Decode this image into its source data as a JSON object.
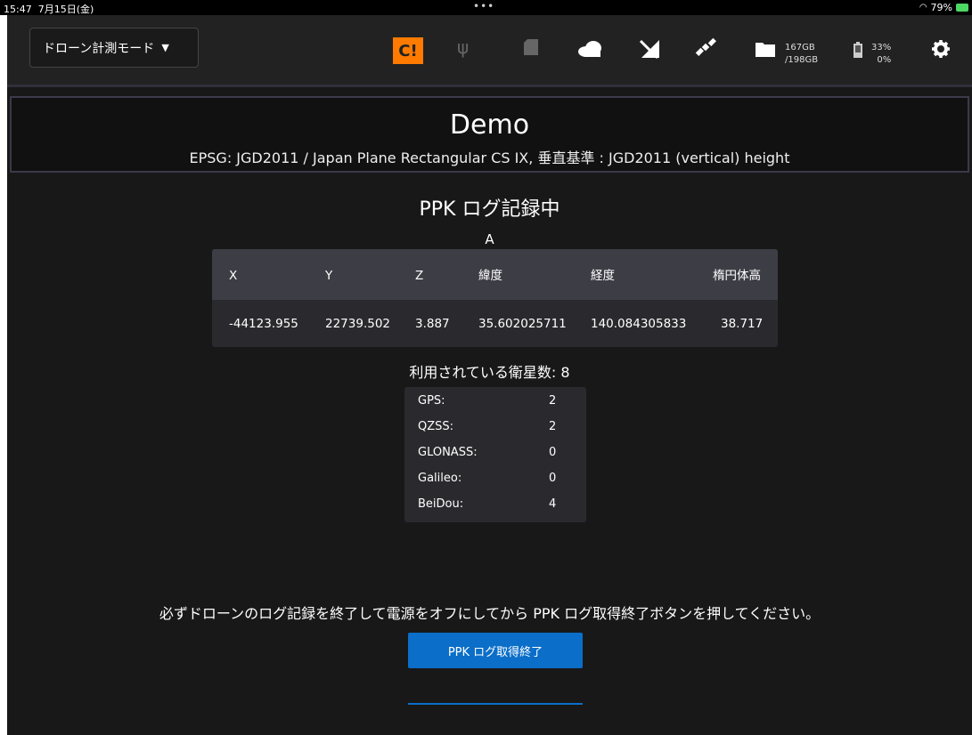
{
  "status_bar": {
    "time": "15:47",
    "date": "7月15日(金)",
    "battery": "79%",
    "dots": "•••"
  },
  "toolbar": {
    "mode_label": "ドローン計測モード",
    "storage_used": "167GB",
    "storage_total": "/198GB",
    "battery_1": "33%",
    "battery_2": "0%",
    "icons": [
      "warning-icon",
      "usb-icon",
      "sd-card-icon",
      "cloud-icon",
      "no-signal-icon",
      "satellite-icon",
      "folder-icon",
      "battery-icon",
      "gear-icon"
    ],
    "accent": "#ff7a00"
  },
  "header": {
    "title": "Demo",
    "epsg": "EPSG: JGD2011 / Japan Plane Rectangular CS IX, 垂直基準 : JGD2011 (vertical) height"
  },
  "main": {
    "status_title": "PPK ログ記録中",
    "fix_status": "A",
    "coords": {
      "headers": [
        "X",
        "Y",
        "Z",
        "緯度",
        "経度",
        "楕円体高"
      ],
      "values": [
        "-44123.955",
        "22739.502",
        "3.887",
        "35.602025711",
        "140.084305833",
        "38.717"
      ]
    },
    "satellites_label": "利用されている衛星数: 8",
    "satellites": [
      {
        "name": "GPS:",
        "count": "2"
      },
      {
        "name": "QZSS:",
        "count": "2"
      },
      {
        "name": "GLONASS:",
        "count": "0"
      },
      {
        "name": "Galileo:",
        "count": "0"
      },
      {
        "name": "BeiDou:",
        "count": "4"
      }
    ],
    "notice": "必ずドローンのログ記録を終了して電源をオフにしてから PPK ログ取得終了ボタンを押してください。",
    "stop_button_label": "PPK ログ取得終了",
    "button_color": "#0b6ec8"
  }
}
